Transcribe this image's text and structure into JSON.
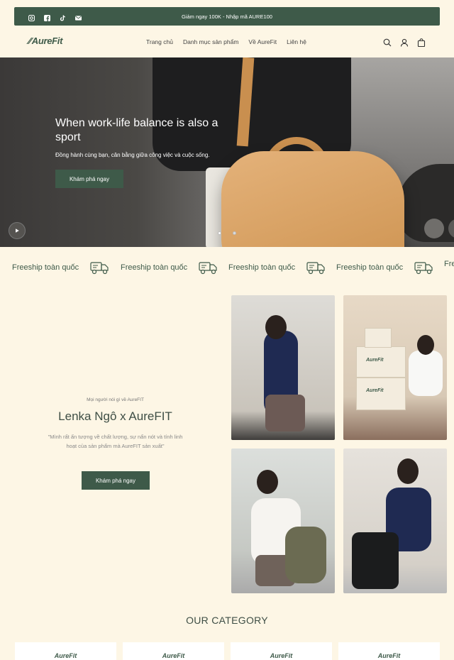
{
  "announcement": {
    "text": "Giảm ngay 100K - Nhập mã AURE100",
    "social_icons": [
      "instagram-icon",
      "facebook-icon",
      "tiktok-icon",
      "email-icon"
    ]
  },
  "header": {
    "logo": "AureFit",
    "nav": [
      "Trang chủ",
      "Danh mục sản phẩm",
      "Về AureFit",
      "Liên hệ"
    ],
    "icons": [
      "search-icon",
      "user-icon",
      "cart-icon"
    ]
  },
  "hero": {
    "title": "When work-life balance is also a sport",
    "subtitle": "Đồng hành cùng bạn, cân bằng giữa công việc và cuộc sống.",
    "cta": "Khám phá ngay",
    "slides": 2,
    "active_slide": 1
  },
  "marquee": {
    "items": [
      "Freeship toàn quốc",
      "Freeship toàn quốc",
      "Freeship toàn quốc",
      "Freeship toàn quốc",
      "Fre"
    ]
  },
  "testimonial": {
    "kicker": "Mọi người nói gì về AureFIT",
    "name": "Lenka Ngô x AureFIT",
    "quote": "\"Mình rất ấn tượng về chất lượng, sự nẩn nót và tính linh hoạt của sản phẩm mà AureFIT sản xuất\"",
    "cta": "Khám phá ngay"
  },
  "gallery": {
    "box_label": "AureFit"
  },
  "category": {
    "title": "OUR CATEGORY",
    "cards": [
      "AureFit",
      "AureFit",
      "AureFit",
      "AureFit"
    ]
  },
  "colors": {
    "accent": "#3e5a49",
    "background": "#fdf6e5"
  }
}
